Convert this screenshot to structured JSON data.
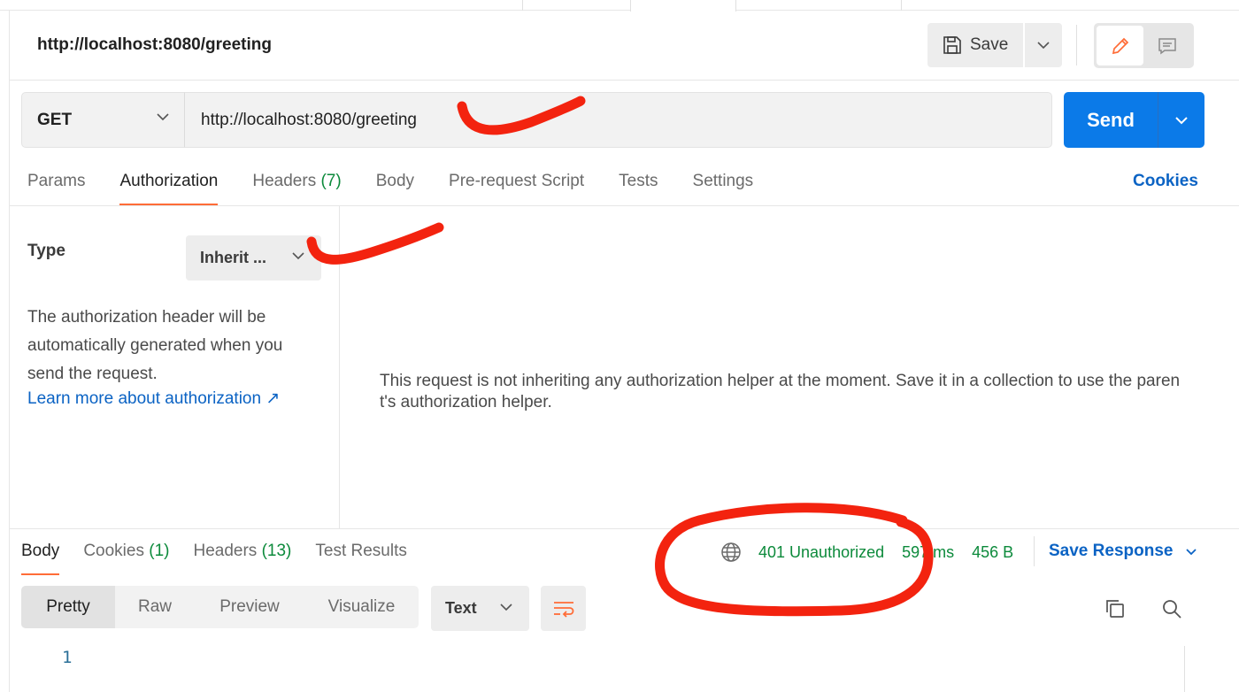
{
  "request": {
    "title": "http://localhost:8080/greeting",
    "save_label": "Save",
    "method": "GET",
    "url": "http://localhost:8080/greeting",
    "send_label": "Send"
  },
  "request_tabs": [
    {
      "label": "Params"
    },
    {
      "label": "Authorization"
    },
    {
      "label": "Headers",
      "count": "(7)"
    },
    {
      "label": "Body"
    },
    {
      "label": "Pre-request Script"
    },
    {
      "label": "Tests"
    },
    {
      "label": "Settings"
    }
  ],
  "cookies_link": "Cookies",
  "auth": {
    "type_label": "Type",
    "type_value": "Inherit ...",
    "description": "The authorization header will be automatically generated when you send the request.",
    "learn_more": "Learn more about authorization ↗",
    "message": "This request is not inheriting any authorization helper at the moment. Save it in a collection to use the parent's authorization helper."
  },
  "response": {
    "tabs": [
      {
        "label": "Body"
      },
      {
        "label": "Cookies",
        "count": "(1)"
      },
      {
        "label": "Headers",
        "count": "(13)"
      },
      {
        "label": "Test Results"
      }
    ],
    "status": "401 Unauthorized",
    "time": "597 ms",
    "size": "456 B",
    "save_response": "Save Response",
    "view_modes": [
      "Pretty",
      "Raw",
      "Preview",
      "Visualize"
    ],
    "format": "Text",
    "line_number": "1"
  },
  "colors": {
    "accent_orange": "#ff6c37",
    "send_blue": "#0b7ae8",
    "link_blue": "#0b63c4",
    "status_green": "#0c8a3b",
    "annotation_red": "#f3230f"
  },
  "icons": [
    "save-icon",
    "chevron-down-icon",
    "pencil-icon",
    "comment-icon",
    "globe-icon",
    "wrap-lines-icon",
    "copy-icon",
    "search-icon"
  ]
}
